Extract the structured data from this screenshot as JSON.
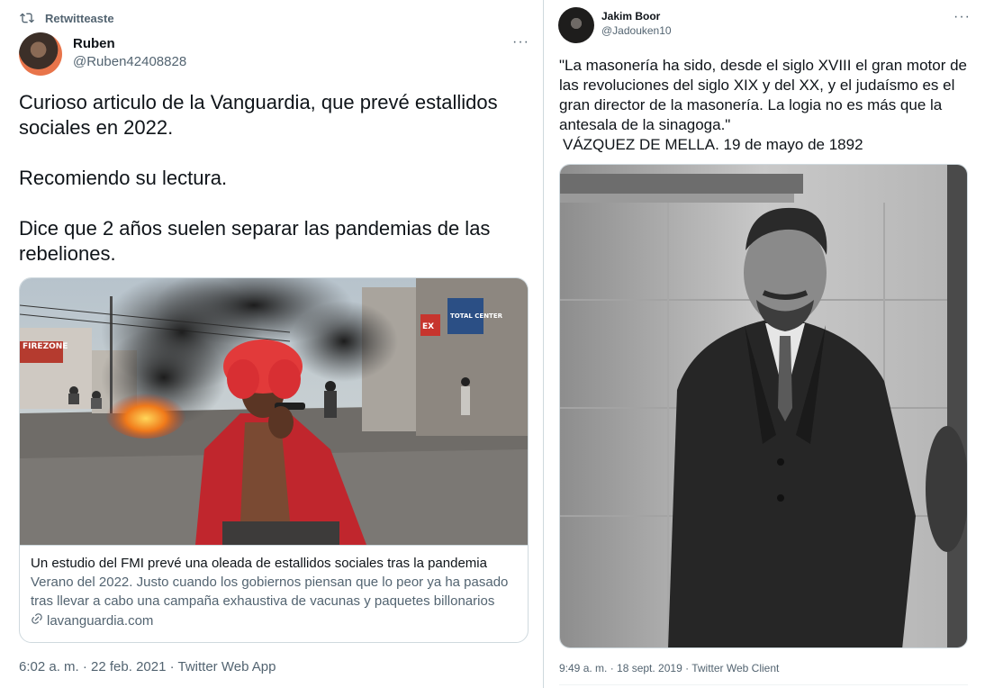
{
  "left_tweet": {
    "retweet_label": "Retwitteaste",
    "author_name": "Ruben",
    "author_handle": "@Ruben42408828",
    "more_label": "···",
    "text": {
      "paragraph_1": "Curioso articulo de la Vanguardia, que prevé estallidos sociales en 2022.",
      "paragraph_2": "Recomiendo su lectura.",
      "paragraph_3": "Dice que 2 años suelen separar las pandemias de las rebeliones."
    },
    "card": {
      "image_signs": {
        "firezone": "FIREZONE",
        "total_center": "TOTAL CENTER",
        "ex_sign": "EX"
      },
      "title": "Un estudio del FMI prevé una oleada de estallidos sociales tras la pandemia",
      "description": "Verano del 2022. Justo cuando los gobiernos piensan que lo peor ya ha pasado tras llevar a cabo una campaña exhaustiva de vacunas y paquetes billonarios de…",
      "domain": "lavanguardia.com"
    },
    "meta": "6:02 a. m. · 22 feb. 2021 · Twitter Web App"
  },
  "right_tweet": {
    "author_name": "Jakim Boor",
    "author_handle": "@Jadouken10",
    "more_label": "···",
    "text": {
      "quote": "\"La masonería ha sido, desde el siglo XVIII el gran motor de las revoluciones del siglo XIX y del XX, y el judaísmo es el gran director de la masonería. La logia no es más que la antesala de la sinagoga.\"",
      "signature": "VÁZQUEZ DE MELLA. 19 de mayo de 1892"
    },
    "meta": "9:49 a. m. · 18 sept. 2019 · Twitter Web Client"
  },
  "colors": {
    "text_primary": "#0f1419",
    "text_secondary": "#536471",
    "border": "#cfd9de",
    "background": "#ffffff"
  },
  "icons": {
    "retweet": "retweet-icon",
    "more": "more-icon",
    "link": "link-icon"
  }
}
